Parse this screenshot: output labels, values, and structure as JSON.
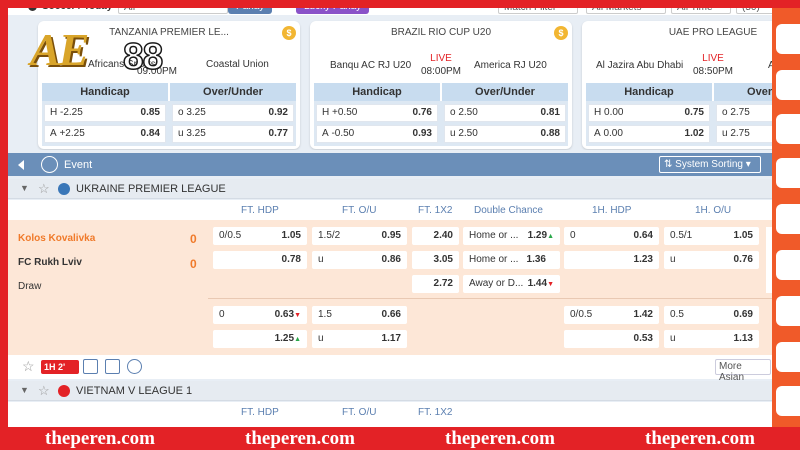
{
  "topbar": {
    "breadcrumb": "Soccer / Today",
    "filter_all": "All",
    "parlay_label": "Parlay",
    "lucky_label": "Lucky Parlay",
    "match_filter": "Match Filter",
    "all_markets": "All Markets",
    "all_time": "All Time",
    "count": "(50)"
  },
  "logo": {
    "text_ae": "AE",
    "text_88": "88"
  },
  "cards": [
    {
      "league": "TANZANIA PREMIER LE...",
      "home": "Africans Sports",
      "away": "Coastal Union",
      "live": "",
      "time": "09:00PM",
      "hdp_rows": [
        {
          "side": "H",
          "line": "-2.25",
          "odds": "0.85"
        },
        {
          "side": "A",
          "line": "+2.25",
          "odds": "0.84"
        }
      ],
      "ou_rows": [
        {
          "side": "o",
          "line": "3.25",
          "odds": "0.92"
        },
        {
          "side": "u",
          "line": "3.25",
          "odds": "0.77"
        }
      ]
    },
    {
      "league": "BRAZIL RIO CUP U20",
      "home": "Banqu AC RJ U20",
      "away": "America RJ U20",
      "live": "LIVE",
      "time": "08:00PM",
      "hdp_rows": [
        {
          "side": "H",
          "line": "+0.50",
          "odds": "0.76"
        },
        {
          "side": "A",
          "line": "-0.50",
          "odds": "0.93"
        }
      ],
      "ou_rows": [
        {
          "side": "o",
          "line": "2.50",
          "odds": "0.81"
        },
        {
          "side": "u",
          "line": "2.50",
          "odds": "0.88"
        }
      ]
    },
    {
      "league": "UAE PRO LEAGUE",
      "home": "Al Jazira Abu Dhabi",
      "away": "A",
      "live": "LIVE",
      "time": "08:50PM",
      "hdp_rows": [
        {
          "side": "H",
          "line": "0.00",
          "odds": "0.75"
        },
        {
          "side": "A",
          "line": "0.00",
          "odds": "1.02"
        }
      ],
      "ou_rows": [
        {
          "side": "o",
          "line": "2.75",
          "odds": ""
        },
        {
          "side": "u",
          "line": "2.75",
          "odds": ""
        }
      ]
    }
  ],
  "market_labels": {
    "handicap": "Handicap",
    "over_under": "Over/Under"
  },
  "event_bar": {
    "label": "Event",
    "sort_label": "System Sorting"
  },
  "leagues": {
    "ukraine": "UKRAINE PREMIER LEAGUE",
    "vietnam": "VIETNAM V LEAGUE 1"
  },
  "columns": {
    "ft_hdp": "FT. HDP",
    "ft_ou": "FT. O/U",
    "ft_1x2": "FT. 1X2",
    "double_chance": "Double Chance",
    "h1_hdp": "1H. HDP",
    "h1_ou": "1H. O/U"
  },
  "match": {
    "home": "Kolos Kovalivka",
    "away": "FC Rukh Lviv",
    "draw": "Draw",
    "home_score": "0",
    "away_score": "0",
    "ft_hdp": [
      {
        "line": "0/0.5",
        "odds": "1.05"
      },
      {
        "line": "",
        "odds": "0.78"
      }
    ],
    "ft_ou": [
      {
        "line": "1.5/2",
        "odds": "0.95"
      },
      {
        "line": "u",
        "odds": "0.86"
      }
    ],
    "ft_1x2": [
      "2.40",
      "3.05",
      "2.72"
    ],
    "double_chance": [
      {
        "label": "Home or ...",
        "odds": "1.29"
      },
      {
        "label": "Home or ...",
        "odds": "1.36"
      },
      {
        "label": "Away or D...",
        "odds": "1.44"
      }
    ],
    "h1_hdp": [
      {
        "line": "0",
        "odds": "0.64"
      },
      {
        "line": "",
        "odds": "1.23"
      }
    ],
    "h1_ou": [
      {
        "line": "0.5/1",
        "odds": "1.05"
      },
      {
        "line": "u",
        "odds": "0.76"
      }
    ],
    "alt_ft_hdp": [
      {
        "line": "0",
        "odds": "0.63"
      },
      {
        "line": "",
        "odds": "1.25"
      }
    ],
    "alt_ft_ou": [
      {
        "line": "1.5",
        "odds": "0.66"
      },
      {
        "line": "u",
        "odds": "1.17"
      }
    ],
    "alt_h1_hdp": [
      {
        "line": "0/0.5",
        "odds": "1.42"
      },
      {
        "line": "",
        "odds": "0.53"
      }
    ],
    "alt_h1_ou": [
      {
        "line": "0.5",
        "odds": "0.69"
      },
      {
        "line": "u",
        "odds": "1.13"
      }
    ]
  },
  "footer_row": {
    "period": "1H",
    "period_num": "2'",
    "more_label": "More Asian"
  },
  "watermark": [
    "theperen.com",
    "theperen.com",
    "theperen.com",
    "theperen.com"
  ],
  "colors": {
    "frame": "#e32226",
    "accent": "#f05a29",
    "header_blue": "#6b8fb9",
    "odds_bg": "#c8dcef",
    "live_red": "#e32226",
    "score_orange": "#f07a2a"
  }
}
